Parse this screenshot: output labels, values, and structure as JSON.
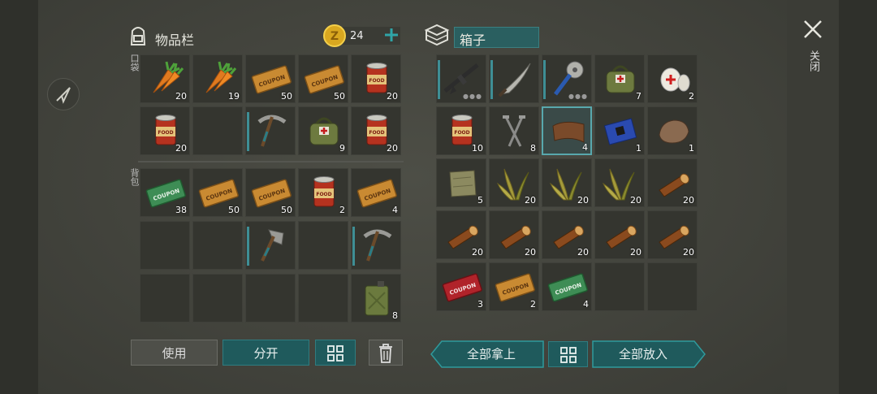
{
  "inventory": {
    "title": "物品栏",
    "coins": "24",
    "pocket_label": "口袋",
    "backpack_label": "背包",
    "pocket_slots": [
      {
        "icon": "carrot-icon",
        "count": "20"
      },
      {
        "icon": "carrot-icon",
        "count": "19"
      },
      {
        "icon": "survival-kit-coupon-icon",
        "count": "50"
      },
      {
        "icon": "survival-kit-coupon-icon",
        "count": "50"
      },
      {
        "icon": "canned-food-icon",
        "count": "20"
      },
      {
        "icon": "canned-food-icon",
        "count": "20"
      },
      {
        "icon": "",
        "count": ""
      },
      {
        "icon": "pickaxe-icon",
        "count": "",
        "bar": true
      },
      {
        "icon": "medkit-bag-icon",
        "count": "9"
      },
      {
        "icon": "canned-food-icon",
        "count": "20"
      }
    ],
    "backpack_slots": [
      {
        "icon": "ration-coupon-icon",
        "count": "38"
      },
      {
        "icon": "survival-kit-coupon-icon",
        "count": "50"
      },
      {
        "icon": "survival-kit-coupon-icon",
        "count": "50"
      },
      {
        "icon": "canned-food-icon",
        "count": "2"
      },
      {
        "icon": "survival-kit-coupon-icon",
        "count": "4"
      },
      {
        "icon": "",
        "count": ""
      },
      {
        "icon": "",
        "count": ""
      },
      {
        "icon": "hatchet-icon",
        "count": "",
        "bar": true
      },
      {
        "icon": "",
        "count": ""
      },
      {
        "icon": "pickaxe-icon",
        "count": "",
        "bar": true
      },
      {
        "icon": "",
        "count": ""
      },
      {
        "icon": "",
        "count": ""
      },
      {
        "icon": "",
        "count": ""
      },
      {
        "icon": "",
        "count": ""
      },
      {
        "icon": "gas-canister-icon",
        "count": "8"
      }
    ],
    "buttons": {
      "use": "使用",
      "split": "分开"
    }
  },
  "box": {
    "title": "箱子",
    "slots": [
      {
        "icon": "rifle-icon",
        "count": "",
        "bar": true,
        "dots": true
      },
      {
        "icon": "machete-icon",
        "count": "",
        "bar": true
      },
      {
        "icon": "saw-blade-club-icon",
        "count": "",
        "bar": true,
        "dots": true
      },
      {
        "icon": "medkit-bag-icon",
        "count": "7"
      },
      {
        "icon": "bandage-icon",
        "count": "2"
      },
      {
        "icon": "canned-food-icon",
        "count": "10"
      },
      {
        "icon": "nails-icon",
        "count": "8"
      },
      {
        "icon": "leather-icon",
        "count": "4",
        "selected": true
      },
      {
        "icon": "circuit-board-icon",
        "count": "1"
      },
      {
        "icon": "stone-icon",
        "count": "1"
      },
      {
        "icon": "cloth-icon",
        "count": "5"
      },
      {
        "icon": "plant-fiber-icon",
        "count": "20"
      },
      {
        "icon": "plant-fiber-icon",
        "count": "20"
      },
      {
        "icon": "plant-fiber-icon",
        "count": "20"
      },
      {
        "icon": "log-icon",
        "count": "20"
      },
      {
        "icon": "log-icon",
        "count": "20"
      },
      {
        "icon": "log-icon",
        "count": "20"
      },
      {
        "icon": "log-icon",
        "count": "20"
      },
      {
        "icon": "log-icon",
        "count": "20"
      },
      {
        "icon": "log-icon",
        "count": "20"
      },
      {
        "icon": "weapon-coupon-icon",
        "count": "3"
      },
      {
        "icon": "survival-kit-coupon-icon",
        "count": "2"
      },
      {
        "icon": "ration-coupon-icon",
        "count": "4"
      },
      {
        "icon": "",
        "count": ""
      },
      {
        "icon": "",
        "count": ""
      }
    ],
    "buttons": {
      "take_all": "全部拿上",
      "put_all": "全部放入"
    }
  },
  "close_label": "关闭",
  "icons": {
    "coupon_text": "COUPON",
    "food_text": "FOOD"
  }
}
